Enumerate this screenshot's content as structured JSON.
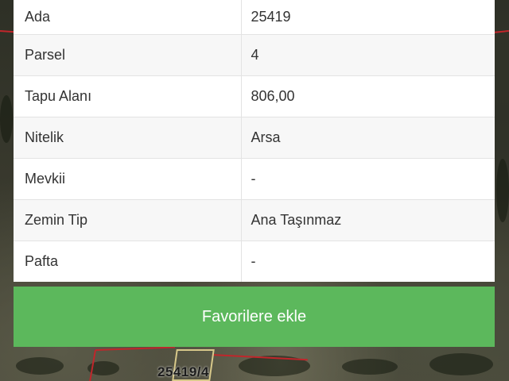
{
  "property_table": {
    "rows": [
      {
        "label": "Ada",
        "value": "25419"
      },
      {
        "label": "Parsel",
        "value": "4"
      },
      {
        "label": "Tapu Alanı",
        "value": "806,00"
      },
      {
        "label": "Nitelik",
        "value": "Arsa"
      },
      {
        "label": "Mevkii",
        "value": "-"
      },
      {
        "label": "Zemin Tip",
        "value": "Ana Taşınmaz"
      },
      {
        "label": "Pafta",
        "value": "-"
      }
    ]
  },
  "actions": {
    "favorite_label": "Favorilere ekle"
  },
  "map": {
    "parcel_label": "25419/4",
    "parcel_line_color": "#c0262b"
  },
  "colors": {
    "button_green": "#5cb85c",
    "row_alt": "#f7f7f7",
    "border": "#e3e3e3"
  }
}
